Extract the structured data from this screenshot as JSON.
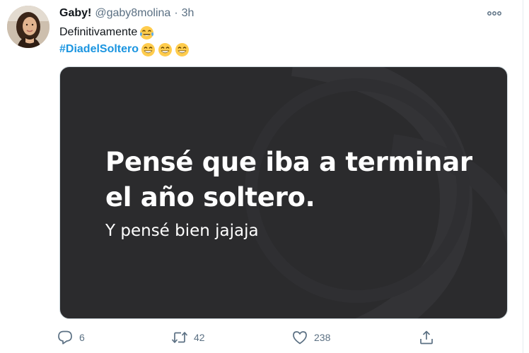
{
  "tweet": {
    "author_name": "Gaby!",
    "author_handle": "@gaby8molina",
    "separator": "·",
    "time": "3h",
    "text_line1": "Definitivamente",
    "hashtag": "#DiadelSoltero",
    "emoji_line1": "face-with-tears-of-joy",
    "emoji_line2": [
      "grinning-face-with-smiling-eyes",
      "grinning-face-with-smiling-eyes",
      "grinning-face-with-smiling-eyes"
    ]
  },
  "media": {
    "headline_line1": "Pensé que iba a terminar",
    "headline_line2": "el año soltero.",
    "subline": "Y pensé bien jajaja"
  },
  "actions": {
    "reply_count": "6",
    "retweet_count": "42",
    "like_count": "238"
  },
  "icons": {
    "more": "more-horizontal-icon",
    "reply": "reply-icon",
    "retweet": "retweet-icon",
    "like": "heart-icon",
    "share": "share-icon"
  },
  "colors": {
    "hashtag": "#1b95e0",
    "secondary_text": "#5b7083",
    "media_background": "#2b2b2d"
  }
}
